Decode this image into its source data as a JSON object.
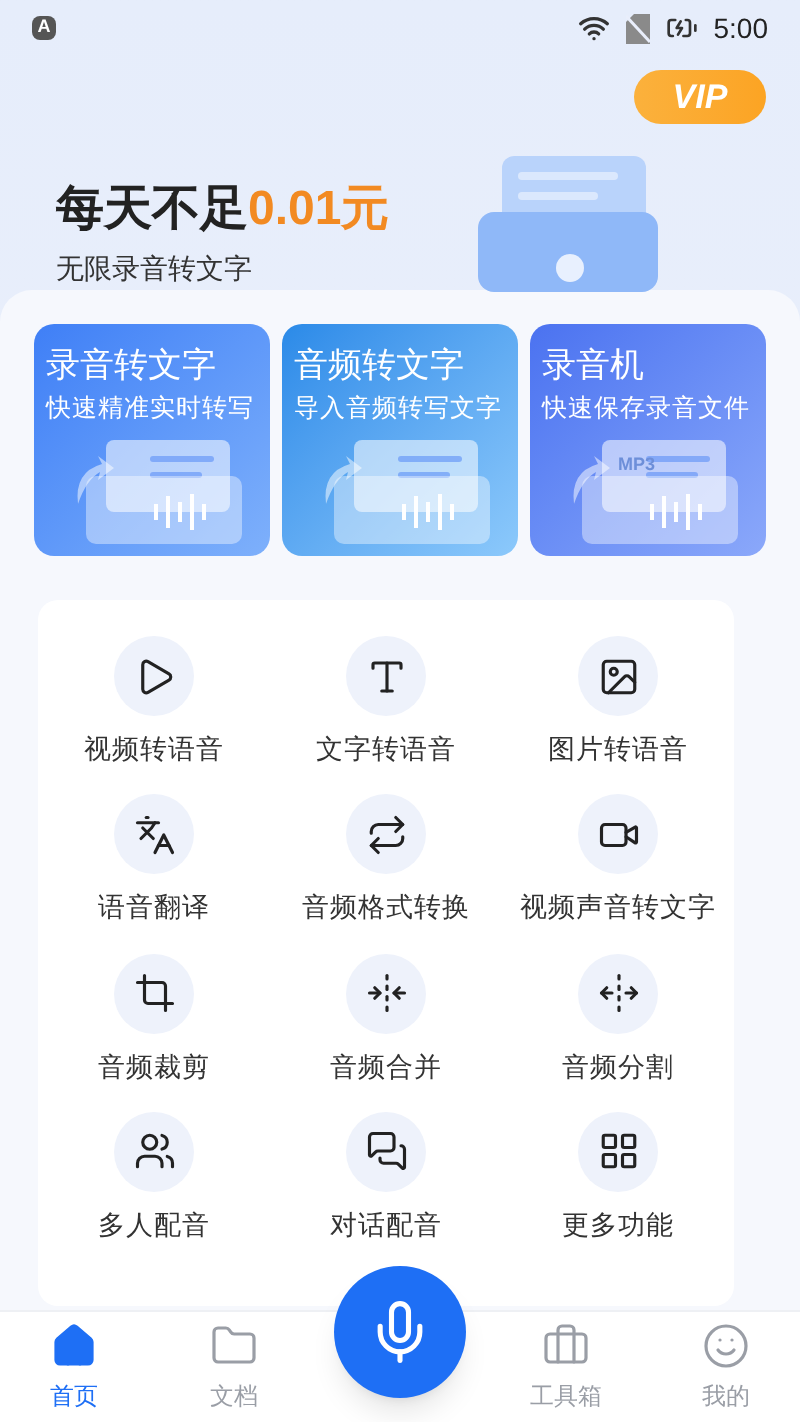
{
  "status_bar": {
    "notification": "A",
    "time": "5:00"
  },
  "header": {
    "vip_badge": "VIP",
    "headline": "每天不足",
    "price": "0.01元",
    "subtitle": "无限录音转文字"
  },
  "feature_cards": [
    {
      "kind": "record",
      "title": "录音转文字",
      "subtitle": "快速精准实时转写"
    },
    {
      "kind": "audio",
      "title": "音频转文字",
      "subtitle": "导入音频转写文字"
    },
    {
      "kind": "recorder",
      "title": "录音机",
      "subtitle": "快速保存录音文件",
      "tag": "MP3"
    }
  ],
  "tools": [
    {
      "kind": "video-voice",
      "label": "视频转语音"
    },
    {
      "kind": "text-voice",
      "label": "文字转语音"
    },
    {
      "kind": "image-voice",
      "label": "图片转语音"
    },
    {
      "kind": "translate",
      "label": "语音翻译"
    },
    {
      "kind": "convert",
      "label": "音频格式转换"
    },
    {
      "kind": "video-text",
      "label": "视频声音转文字"
    },
    {
      "kind": "crop",
      "label": "音频裁剪"
    },
    {
      "kind": "merge",
      "label": "音频合并"
    },
    {
      "kind": "split",
      "label": "音频分割"
    },
    {
      "kind": "people",
      "label": "多人配音"
    },
    {
      "kind": "chat",
      "label": "对话配音"
    },
    {
      "kind": "more",
      "label": "更多功能"
    }
  ],
  "bottom_nav": [
    {
      "kind": "home",
      "label": "首页",
      "selected": true
    },
    {
      "kind": "docs",
      "label": "文档",
      "selected": false
    },
    {
      "kind": "toolbox",
      "label": "工具箱",
      "selected": false
    },
    {
      "kind": "me",
      "label": "我的",
      "selected": false
    }
  ]
}
